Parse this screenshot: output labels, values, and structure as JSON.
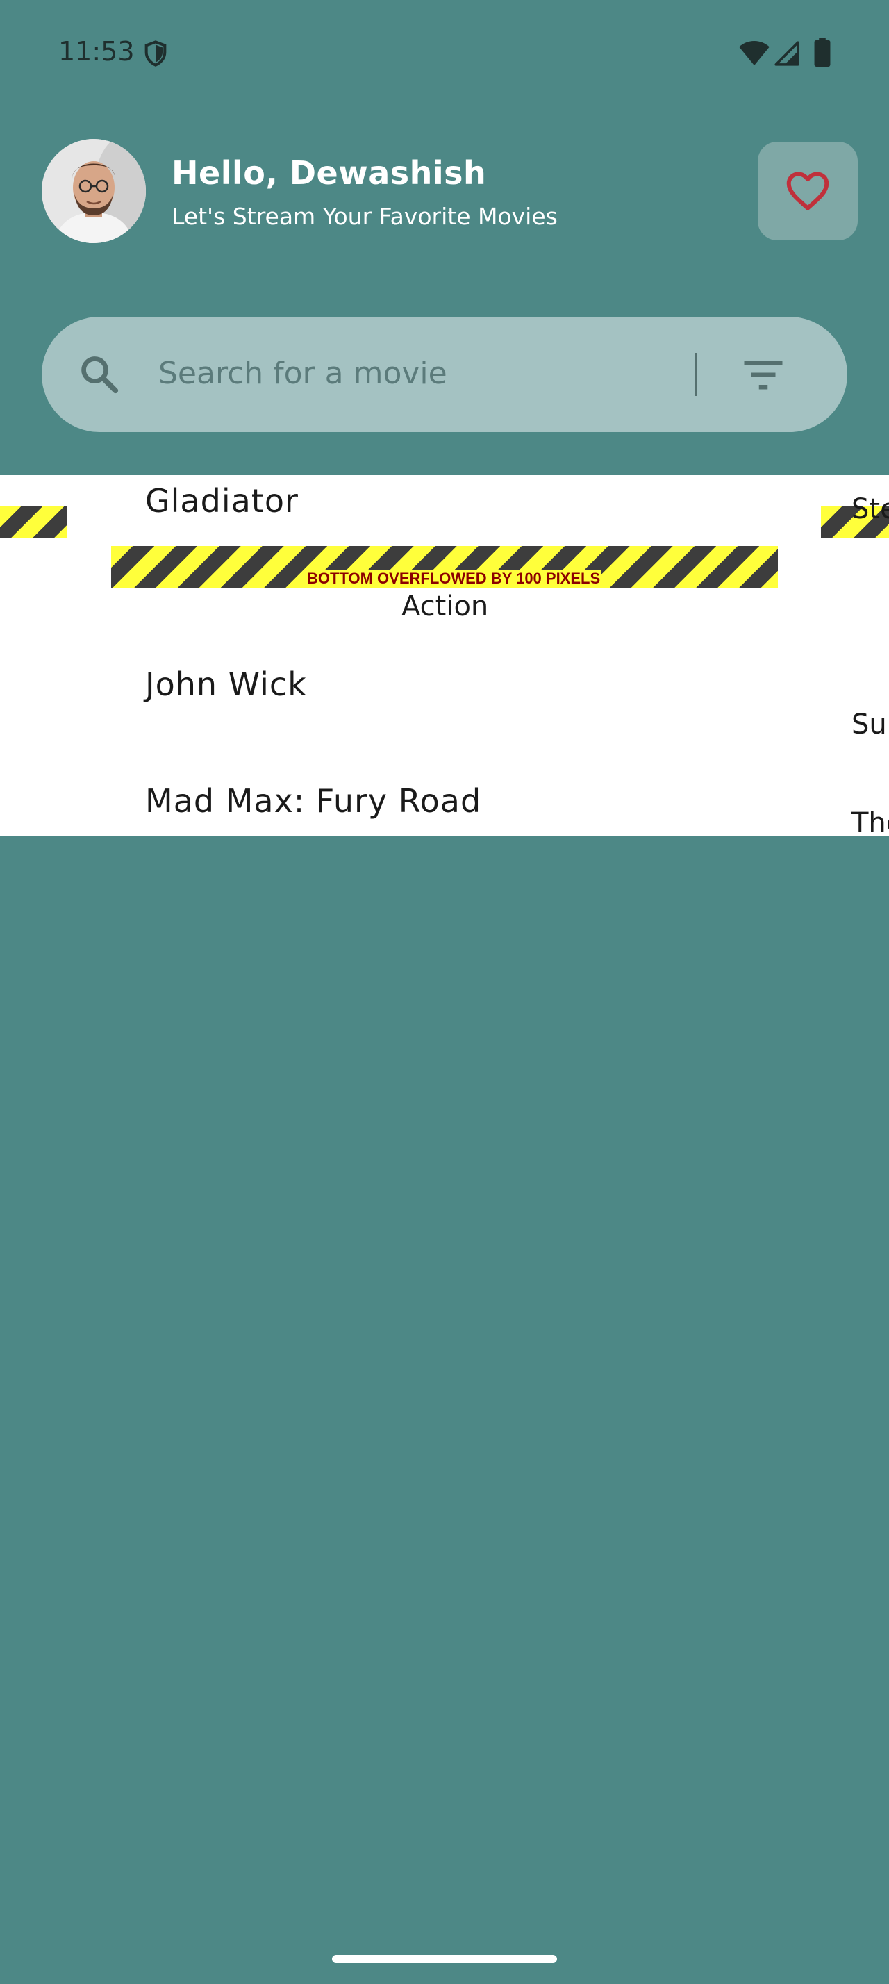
{
  "status_bar": {
    "time": "11:53"
  },
  "header": {
    "greeting": "Hello, Dewashish",
    "subtitle": "Let's Stream Your Favorite Movies"
  },
  "search": {
    "placeholder": "Search for a movie"
  },
  "movies": {
    "items": [
      {
        "title": "Gladiator",
        "genre": "Action"
      },
      {
        "title": "John Wick"
      },
      {
        "title": "Mad Max: Fury Road"
      }
    ],
    "overflow_warning": "BOTTOM OVERFLOWED BY 100 PIXELS",
    "clipped_right": [
      "Ste",
      "Sup",
      "The"
    ]
  },
  "colors": {
    "background": "#4d8886",
    "search_bar": "#a4c2c2",
    "favorite_button": "#7fa8a6",
    "heart": "#c0303b",
    "content_panel": "#ffffff",
    "hazard_yellow": "#ffff3b",
    "hazard_dark": "#3d3d3d",
    "overflow_text": "#8b0000"
  },
  "icons": {
    "status_shield": "shield-icon",
    "wifi": "wifi-icon",
    "signal": "signal-icon",
    "battery": "battery-icon",
    "favorite": "heart-icon",
    "search": "search-icon",
    "filter": "filter-icon"
  }
}
